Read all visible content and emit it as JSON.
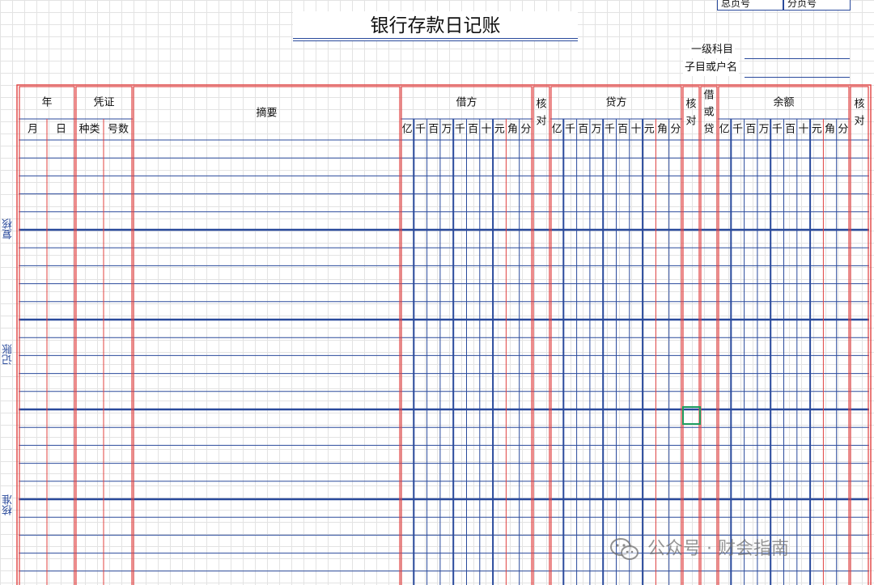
{
  "document": {
    "title": "银行存款日记账",
    "ref_boxes": [
      "总页号",
      "分页号"
    ],
    "account_labels": [
      "一级科目",
      "子目或户名"
    ],
    "side_labels": [
      "复核",
      "记账",
      "核准"
    ]
  },
  "table": {
    "header_year": "年",
    "header_voucher": "凭证",
    "header_summary": "摘要",
    "header_debit": "借方",
    "header_credit": "贷方",
    "header_balance": "余额",
    "header_check": [
      "核",
      "对"
    ],
    "header_direction": [
      "借",
      "或",
      "贷"
    ],
    "sub_month": "月",
    "sub_day": "日",
    "sub_kind": "种类",
    "sub_number": "号数",
    "digit_units": [
      "亿",
      "千",
      "百",
      "万",
      "千",
      "百",
      "十",
      "元",
      "角",
      "分"
    ],
    "body_rows": 25,
    "group_size": 5
  },
  "watermark": {
    "icon": "wechat-icon",
    "text": "公众号 · 财会指南"
  },
  "colors": {
    "section_border": "#e0403f",
    "grid_line": "#2a4a9c",
    "group_separator": "#2a4a9c",
    "selection": "#1f9e5f"
  }
}
